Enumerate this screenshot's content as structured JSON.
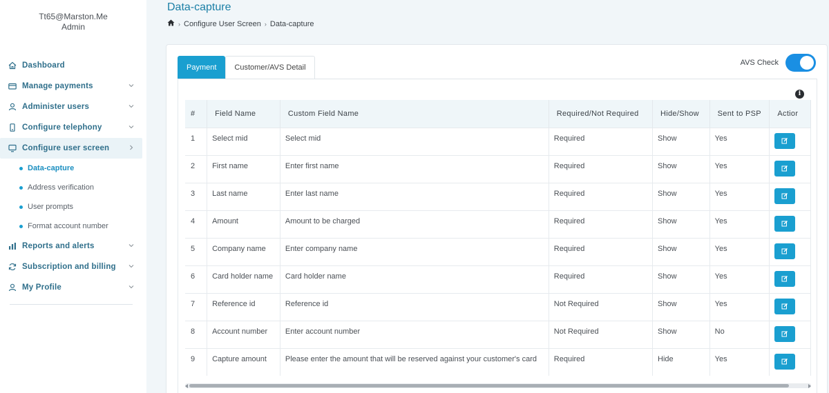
{
  "user": {
    "email": "Tt65@Marston.Me",
    "role": "Admin"
  },
  "sidebar": {
    "items": [
      {
        "label": "Dashboard",
        "icon": "home-icon",
        "expandable": false
      },
      {
        "label": "Manage payments",
        "icon": "credit-card-icon",
        "expandable": true
      },
      {
        "label": "Administer users",
        "icon": "user-icon",
        "expandable": true
      },
      {
        "label": "Configure telephony",
        "icon": "phone-icon",
        "expandable": true
      },
      {
        "label": "Configure user screen",
        "icon": "monitor-icon",
        "expandable": true,
        "active": true
      }
    ],
    "subitems": [
      {
        "label": "Data-capture",
        "active": true
      },
      {
        "label": "Address verification"
      },
      {
        "label": "User prompts"
      },
      {
        "label": "Format account number"
      }
    ],
    "items_after": [
      {
        "label": "Reports and alerts",
        "icon": "bar-chart-icon"
      },
      {
        "label": "Subscription and billing",
        "icon": "refresh-icon"
      },
      {
        "label": "My Profile",
        "icon": "user-icon"
      }
    ]
  },
  "header": {
    "title": "Data-capture",
    "breadcrumb": [
      "Configure User Screen",
      "Data-capture"
    ]
  },
  "tabs": [
    {
      "label": "Payment",
      "active": true
    },
    {
      "label": "Customer/AVS Detail",
      "active": false
    }
  ],
  "avs": {
    "label": "AVS Check",
    "enabled": true
  },
  "table": {
    "columns": [
      "#",
      "Field Name",
      "Custom Field Name",
      "Required/Not Required",
      "Hide/Show",
      "Sent to PSP",
      "Actior"
    ],
    "rows": [
      [
        "1",
        "Select mid",
        "Select mid",
        "Required",
        "Show",
        "Yes"
      ],
      [
        "2",
        "First name",
        "Enter first name",
        "Required",
        "Show",
        "Yes"
      ],
      [
        "3",
        "Last name",
        "Enter last name",
        "Required",
        "Show",
        "Yes"
      ],
      [
        "4",
        "Amount",
        "Amount to be charged",
        "Required",
        "Show",
        "Yes"
      ],
      [
        "5",
        "Company name",
        "Enter company name",
        "Required",
        "Show",
        "Yes"
      ],
      [
        "6",
        "Card holder name",
        "Card holder name",
        "Required",
        "Show",
        "Yes"
      ],
      [
        "7",
        "Reference id",
        "Reference id",
        "Not Required",
        "Show",
        "Yes"
      ],
      [
        "8",
        "Account number",
        "Enter account number",
        "Not Required",
        "Show",
        "No"
      ],
      [
        "9",
        "Capture amount",
        "Please enter the amount that will be reserved against your customer's card",
        "Required",
        "Hide",
        "Yes"
      ]
    ]
  },
  "colors": {
    "accent": "#1a9fd0",
    "title": "#1b7fa6",
    "toggle": "#1a8fe3"
  }
}
